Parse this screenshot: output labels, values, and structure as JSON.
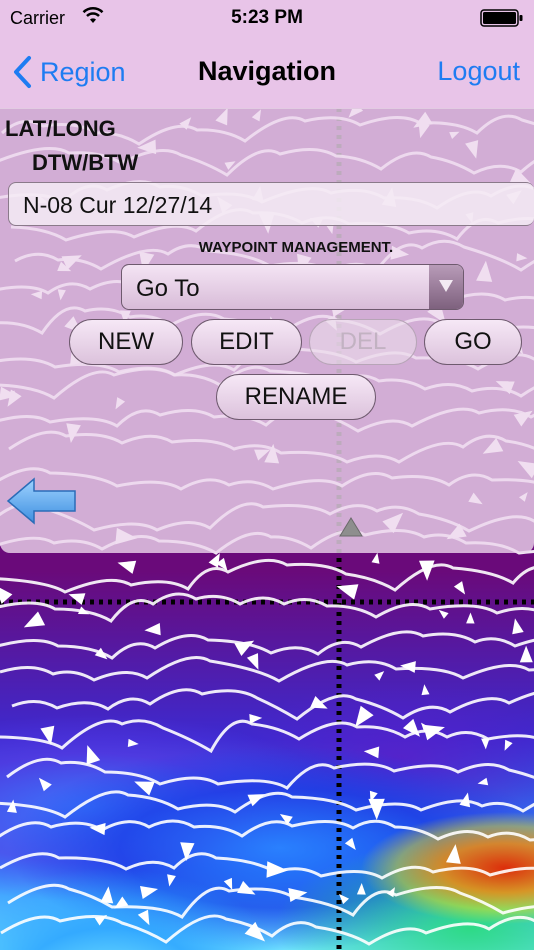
{
  "status_bar": {
    "carrier": "Carrier",
    "time": "5:23 PM",
    "wifi_icon": "wifi-icon",
    "battery_icon": "battery-icon"
  },
  "nav_bar": {
    "back_label": "Region",
    "title": "Navigation",
    "logout_label": "Logout",
    "back_icon": "chevron-left-icon"
  },
  "panel": {
    "lat_long_label": "LAT/LONG",
    "dtw_btw_label": "DTW/BTW",
    "route_value": "N-08 Cur 12/27/14",
    "waypoint_heading": "WAYPOINT MANAGEMENT.",
    "action_select": {
      "selected": "Go To",
      "icon": "triangle-down-icon"
    },
    "buttons": {
      "new": "NEW",
      "edit": "EDIT",
      "del": "DEL",
      "go": "GO",
      "rename": "RENAME"
    },
    "back_arrow_icon": "arrow-left-icon",
    "collapse_icon": "triangle-up-icon"
  },
  "colors": {
    "accent": "#1e7cf2",
    "bar_background": "#e8c4e8",
    "map_base": "#6a0a7a"
  }
}
